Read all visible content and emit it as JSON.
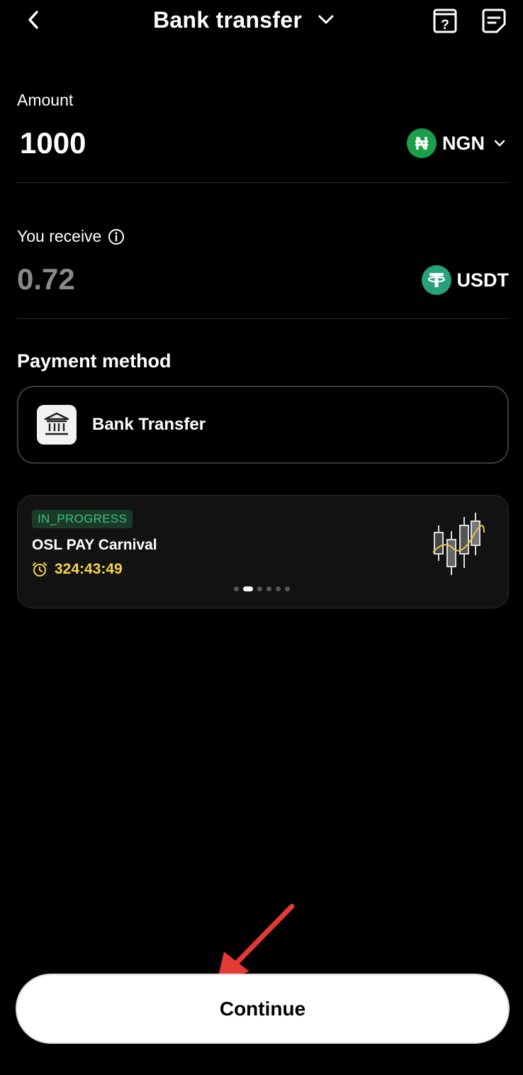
{
  "header": {
    "title": "Bank transfer",
    "back_icon": "chevron-left-icon",
    "title_dropdown_icon": "chevron-down-icon",
    "help_icon": "help-document-icon",
    "orders_icon": "order-list-icon"
  },
  "amount": {
    "label": "Amount",
    "value": "1000",
    "currency": "NGN",
    "currency_symbol": "₦",
    "currency_color": "#1aa04a"
  },
  "receive": {
    "label": "You receive",
    "value": "0.72",
    "currency": "USDT",
    "currency_symbol": "T",
    "currency_color": "#26a17b"
  },
  "payment": {
    "section_title": "Payment method",
    "method_label": "Bank Transfer",
    "method_icon": "bank-icon"
  },
  "promo": {
    "status": "IN_PROGRESS",
    "title": "OSL PAY Carnival",
    "countdown": "324:43:49",
    "countdown_color": "#f3d54e",
    "slides": 6,
    "active_slide": 2
  },
  "actions": {
    "continue_label": "Continue"
  },
  "colors": {
    "background": "#000000",
    "annotation_arrow": "#e53935"
  }
}
